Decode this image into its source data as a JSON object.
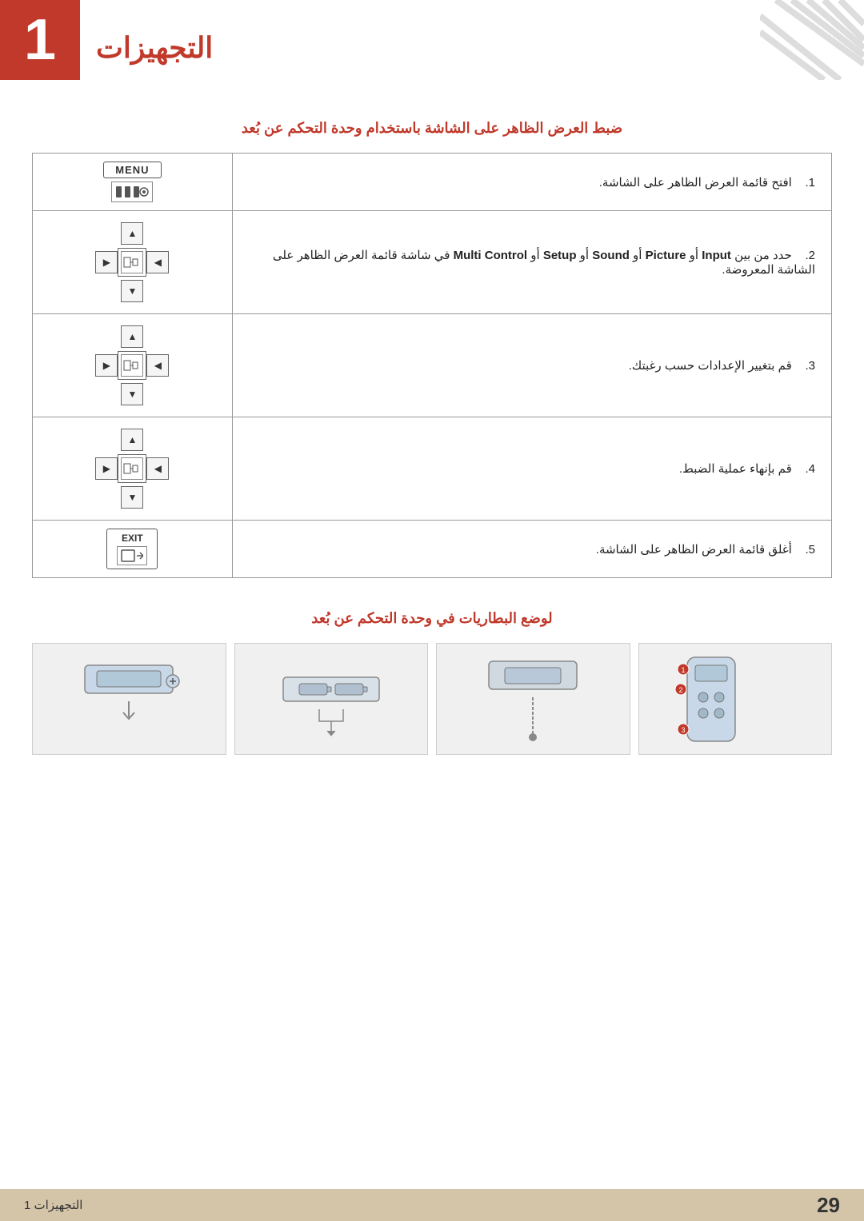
{
  "header": {
    "chapter_number": "1",
    "chapter_title_ar": "التجهيزات",
    "diagonal_color": "#c0392b"
  },
  "section1": {
    "title": "ضبط العرض الظاهر على الشاشة باستخدام وحدة التحكم عن بُعد",
    "steps": [
      {
        "number": "1",
        "text_ar": "افتح قائمة العرض الظاهر على الشاشة.",
        "icon": "menu"
      },
      {
        "number": "2",
        "text_ar": "حدد من بين ",
        "text_keywords": "Input أو Picture أو Sound أو Setup أو Multi Control",
        "text_ar2": " في شاشة قائمة العرض الظاهر على الشاشة المعروضة.",
        "icon": "dpad"
      },
      {
        "number": "3",
        "text_ar": "قم بتغيير الإعدادات حسب رغبتك.",
        "icon": "dpad"
      },
      {
        "number": "4",
        "text_ar": "قم بإنهاء عملية الضبط.",
        "icon": "dpad"
      },
      {
        "number": "5",
        "text_ar": "أغلق قائمة العرض الظاهر على الشاشة.",
        "icon": "exit"
      }
    ],
    "keyword_sound": "Sound"
  },
  "section2": {
    "title": "لوضع البطاريات في وحدة التحكم عن بُعد",
    "images_count": 4
  },
  "footer": {
    "page_number": "29",
    "chapter_label": "التجهيزات 1"
  }
}
